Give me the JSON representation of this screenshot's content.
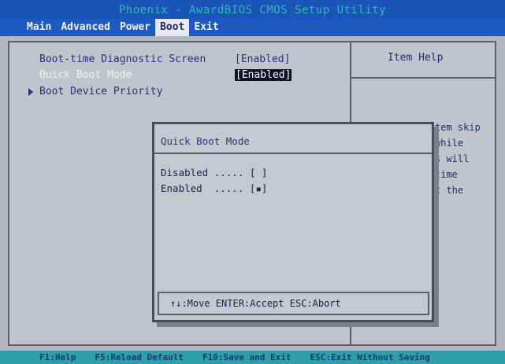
{
  "title": "Phoenix - AwardBIOS CMOS Setup Utility",
  "menu": [
    {
      "label": "Main"
    },
    {
      "label": "Advanced"
    },
    {
      "label": "Power"
    },
    {
      "label": "Boot",
      "active": true
    },
    {
      "label": "Exit"
    }
  ],
  "options": [
    {
      "label": "Boot-time Diagnostic Screen",
      "value": "[Enabled]"
    },
    {
      "label": "Quick Boot Mode",
      "value": "[Enabled]",
      "selected": true
    },
    {
      "label": "Boot Device Priority",
      "submenu": true
    }
  ],
  "help": {
    "title": "Item Help",
    "lines": [
      "tem skip",
      "while",
      "s will",
      "time",
      "t the"
    ]
  },
  "popup": {
    "title": "Quick Boot Mode",
    "options": [
      {
        "label": "Disabled ..... [ ]"
      },
      {
        "label": "Enabled  ..... [▪]"
      }
    ],
    "footer": "↑↓:Move ENTER:Accept ESC:Abort"
  },
  "key_bar": [
    {
      "label": "F1:Help"
    },
    {
      "label": "F5:Reload Default"
    },
    {
      "label": "F10:Save and Exit"
    },
    {
      "label": "ESC:Exit Without Saving"
    }
  ],
  "colors": {
    "menu_bg": "#1d59c2",
    "title_text": "#2fb8b0",
    "panel_bg": "#c2c4cc",
    "highlight_bg": "#0b0f2a",
    "key_bar_bg": "#2e9fa6"
  }
}
